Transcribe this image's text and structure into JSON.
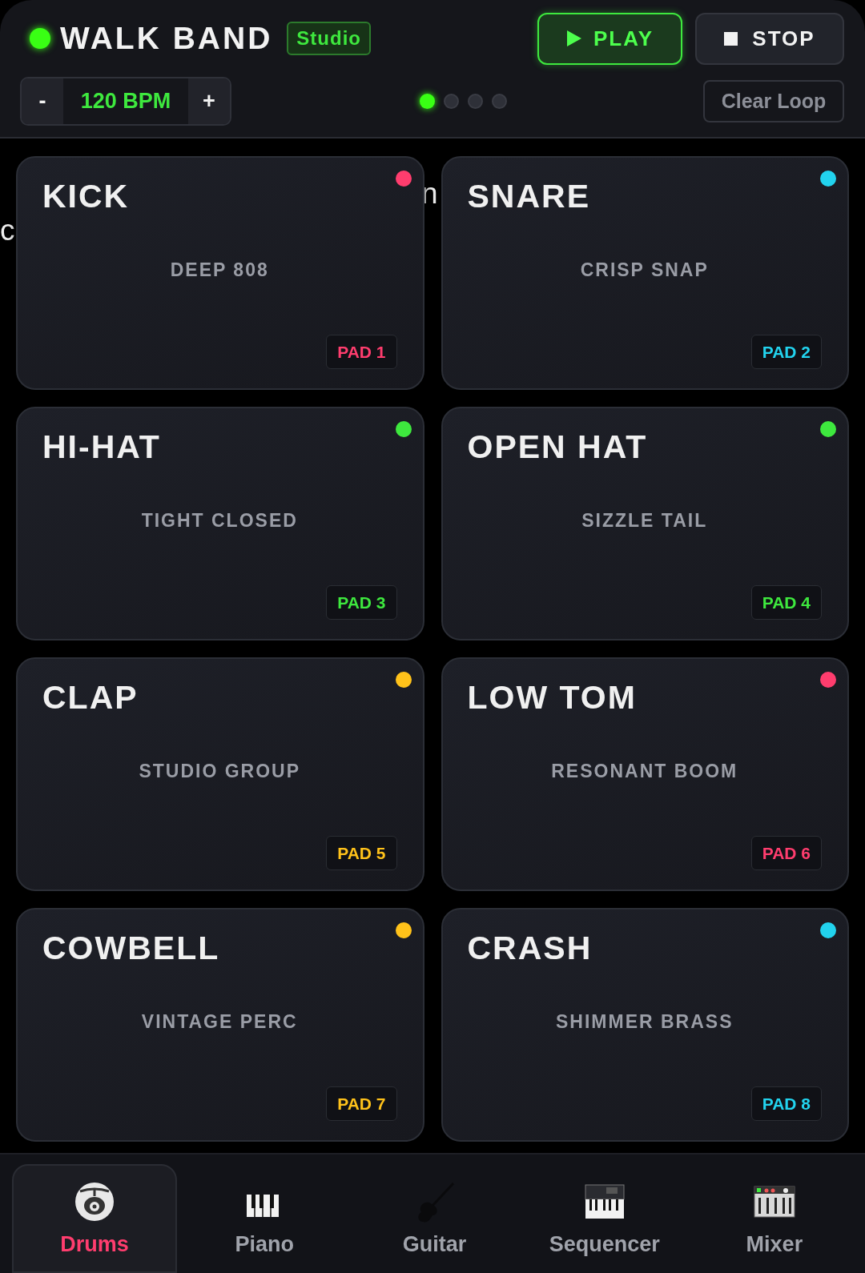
{
  "app": {
    "title": "WALK BAND",
    "badge": "Studio",
    "online": true
  },
  "transport": {
    "play": "PLAY",
    "stop": "STOP",
    "playing": true
  },
  "tempo": {
    "minus": "-",
    "value": "120 BPM",
    "plus": "+"
  },
  "loop_steps": [
    {
      "selected": true
    },
    {
      "selected": false
    },
    {
      "selected": false
    },
    {
      "selected": false
    }
  ],
  "clear_loop": "Clear Loop",
  "background_text": [
    {
      "text": "n",
      "kind": "gap"
    },
    {
      "text": "c",
      "kind": "edge"
    }
  ],
  "pads": [
    {
      "name": "KICK",
      "sound": "DEEP 808",
      "label": "PAD 1",
      "color": "#ff3d6e"
    },
    {
      "name": "SNARE",
      "sound": "CRISP SNAP",
      "label": "PAD 2",
      "color": "#22d3ee"
    },
    {
      "name": "HI-HAT",
      "sound": "TIGHT CLOSED",
      "label": "PAD 3",
      "color": "#3ee83e"
    },
    {
      "name": "OPEN HAT",
      "sound": "SIZZLE TAIL",
      "label": "PAD 4",
      "color": "#3ee83e"
    },
    {
      "name": "CLAP",
      "sound": "STUDIO GROUP",
      "label": "PAD 5",
      "color": "#ffc21a"
    },
    {
      "name": "LOW TOM",
      "sound": "RESONANT BOOM",
      "label": "PAD 6",
      "color": "#ff3d6e"
    },
    {
      "name": "COWBELL",
      "sound": "VINTAGE PERC",
      "label": "PAD 7",
      "color": "#ffc21a"
    },
    {
      "name": "CRASH",
      "sound": "SHIMMER BRASS",
      "label": "PAD 8",
      "color": "#22d3ee"
    }
  ],
  "nav": [
    {
      "label": "Drums",
      "kind": "drums",
      "selected": true
    },
    {
      "label": "Piano",
      "kind": "piano",
      "selected": false
    },
    {
      "label": "Guitar",
      "kind": "guitar",
      "selected": false
    },
    {
      "label": "Sequencer",
      "kind": "sequencer",
      "selected": false
    },
    {
      "label": "Mixer",
      "kind": "mixer",
      "selected": false
    }
  ]
}
